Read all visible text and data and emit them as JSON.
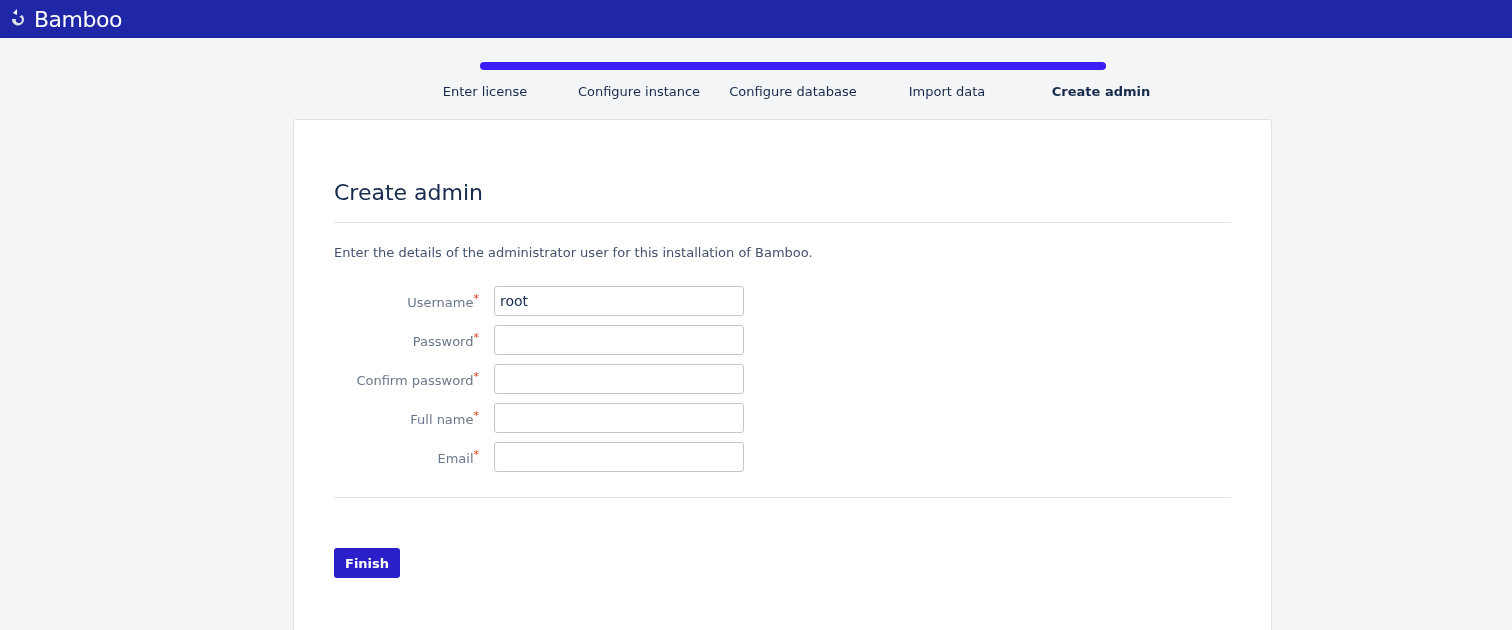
{
  "header": {
    "product": "Bamboo"
  },
  "progress": {
    "level": 1
  },
  "steps": [
    {
      "label": "Enter license",
      "selected": false
    },
    {
      "label": "Configure instance",
      "selected": false
    },
    {
      "label": "Configure database",
      "selected": false
    },
    {
      "label": "Import data",
      "selected": false
    },
    {
      "label": "Create admin",
      "selected": true
    }
  ],
  "form": {
    "title": "Create admin",
    "description": "Enter the details of the administrator user for this installation of Bamboo.",
    "fields": [
      {
        "label": "Username",
        "required": true,
        "required_mark": "*",
        "value": "root"
      },
      {
        "label": "Password",
        "required": true,
        "required_mark": "*"
      },
      {
        "label": "Confirm password",
        "required": true,
        "required_mark": "*"
      },
      {
        "label": "Full name",
        "required": true,
        "required_mark": "*"
      },
      {
        "label": "Email",
        "required": true,
        "required_mark": "*"
      }
    ],
    "submit": "Finish"
  }
}
